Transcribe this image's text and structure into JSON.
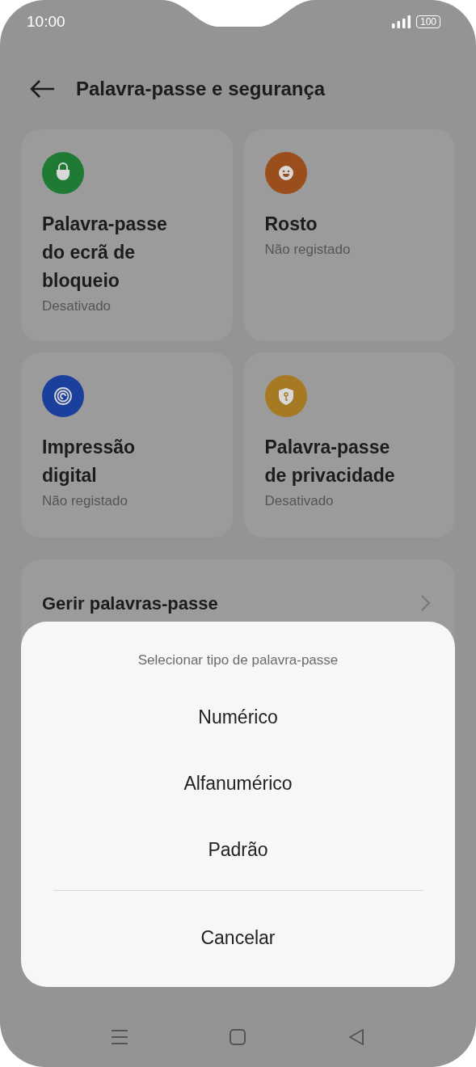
{
  "status_bar": {
    "time": "10:00",
    "battery": "100"
  },
  "header": {
    "title": "Palavra-passe e segurança"
  },
  "cards": [
    {
      "kind": "lock",
      "color": "#1f7a34",
      "title": "Palavra-passe do ecrã de bloqueio",
      "status": "Desativado"
    },
    {
      "kind": "face",
      "color": "#9a4e1c",
      "title": "Rosto",
      "status": "Não registado"
    },
    {
      "kind": "fingerprint",
      "color": "#1a3f9c",
      "title": "Impressão digital",
      "status": "Não registado"
    },
    {
      "kind": "shield",
      "color": "#a57a22",
      "title": "Palavra-passe de privacidade",
      "status": "Desativado"
    }
  ],
  "list_item": {
    "label": "Gerir palavras-passe"
  },
  "sheet": {
    "title": "Selecionar tipo de palavra-passe",
    "options": [
      "Numérico",
      "Alfanumérico",
      "Padrão"
    ],
    "cancel": "Cancelar"
  }
}
